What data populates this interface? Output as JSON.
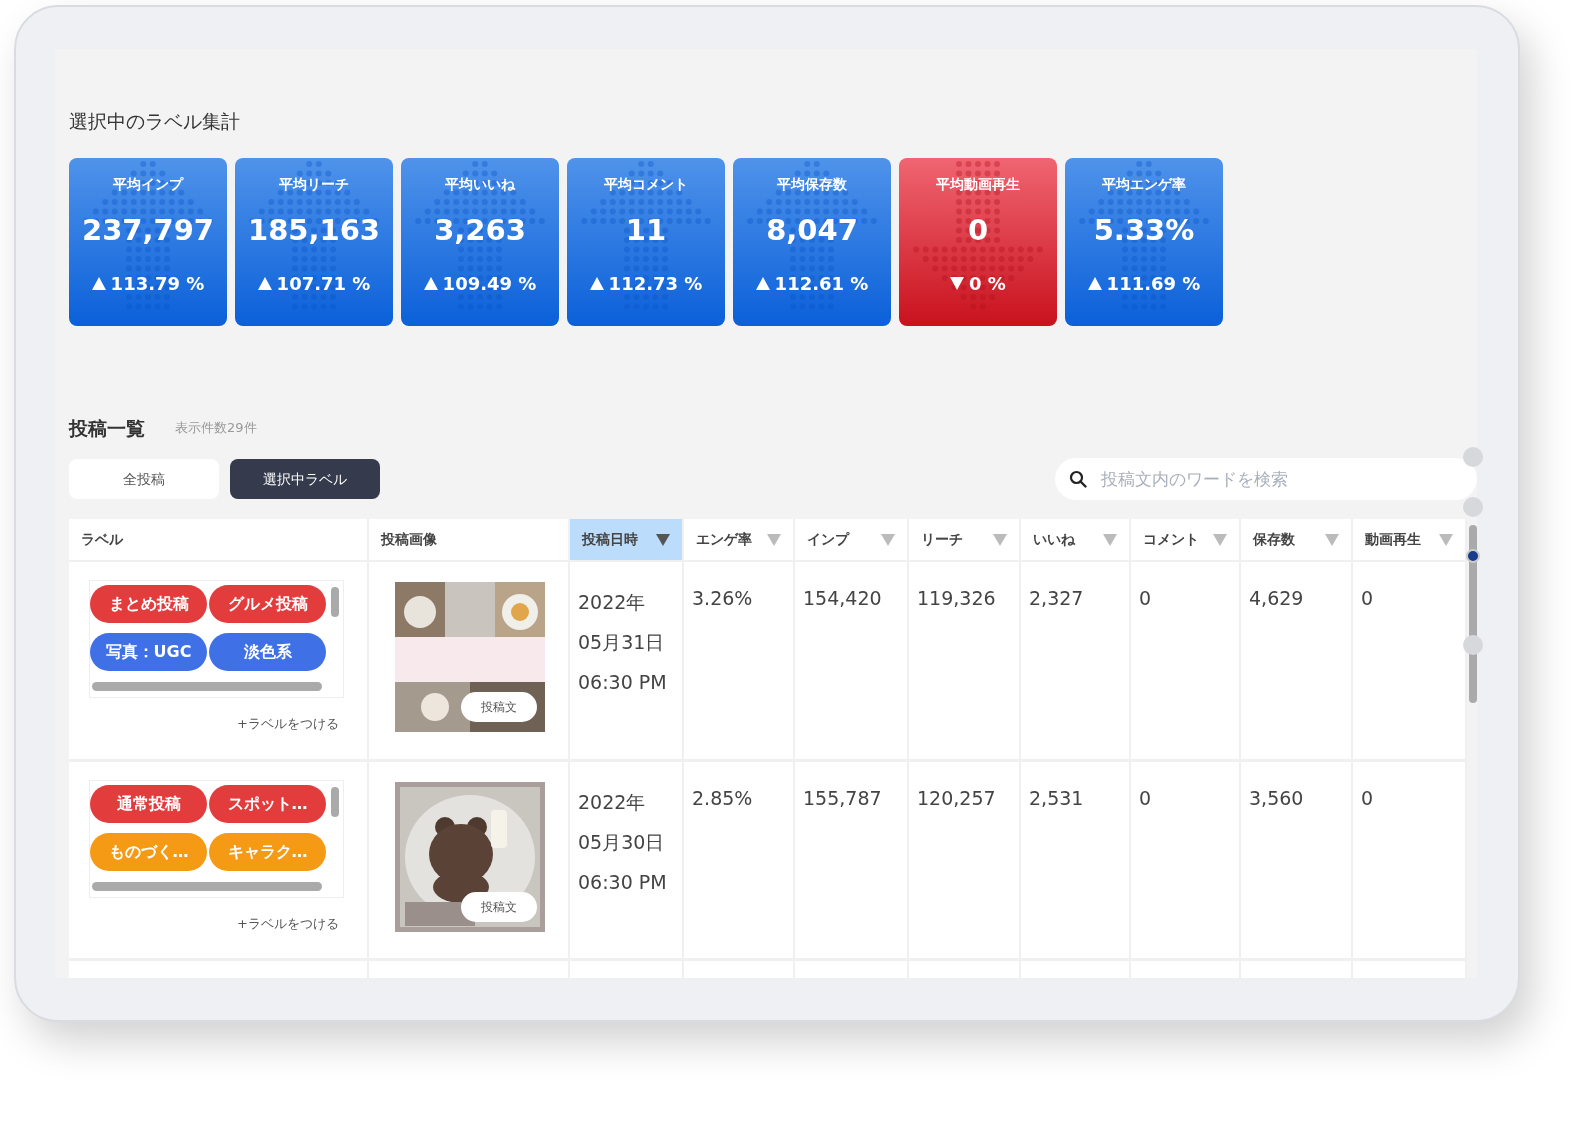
{
  "section_title": "選択中のラベル集計",
  "stat_cards": [
    {
      "title": "平均インプ",
      "value": "237,797",
      "change": "113.79 %",
      "up": true
    },
    {
      "title": "平均リーチ",
      "value": "185,163",
      "change": "107.71 %",
      "up": true
    },
    {
      "title": "平均いいね",
      "value": "3,263",
      "change": "109.49 %",
      "up": true
    },
    {
      "title": "平均コメント",
      "value": "11",
      "change": "112.73 %",
      "up": true
    },
    {
      "title": "平均保存数",
      "value": "8,047",
      "change": "112.61 %",
      "up": true
    },
    {
      "title": "平均動画再生",
      "value": "0",
      "change": "0 %",
      "up": false
    },
    {
      "title": "平均エンゲ率",
      "value": "5.33%",
      "change": "111.69 %",
      "up": true
    }
  ],
  "posts_heading": "投稿一覧",
  "count_label": "表示件数29件",
  "tabs": [
    {
      "label": "全投稿",
      "selected": false
    },
    {
      "label": "選択中ラベル",
      "selected": true
    }
  ],
  "search": {
    "placeholder": "投稿文内のワードを検索"
  },
  "table": {
    "columns": [
      {
        "label": "ラベル",
        "sortable": false,
        "sorted": false
      },
      {
        "label": "投稿画像",
        "sortable": false,
        "sorted": false
      },
      {
        "label": "投稿日時",
        "sortable": true,
        "sorted": true
      },
      {
        "label": "エンゲ率",
        "sortable": true,
        "sorted": false
      },
      {
        "label": "インプ",
        "sortable": true,
        "sorted": false
      },
      {
        "label": "リーチ",
        "sortable": true,
        "sorted": false
      },
      {
        "label": "いいね",
        "sortable": true,
        "sorted": false
      },
      {
        "label": "コメント",
        "sortable": true,
        "sorted": false
      },
      {
        "label": "保存数",
        "sortable": true,
        "sorted": false
      },
      {
        "label": "動画再生",
        "sortable": true,
        "sorted": false
      }
    ],
    "rows": [
      {
        "cells": [
          {
            "kind": "tags",
            "tags": [
              {
                "text": "まとめ投稿",
                "color": "#e23c3c"
              },
              {
                "text": "グルメ投稿",
                "color": "#e23c3c"
              },
              {
                "text": "写真：UGC",
                "color": "#3f70e6"
              },
              {
                "text": "淡色系",
                "color": "#3f70e6"
              }
            ],
            "link": "+ラベルをつける"
          },
          {
            "kind": "picture",
            "button": "投稿文"
          },
          {
            "kind": "lines",
            "lines": [
              "2022年",
              "05月31日",
              "06:30 PM"
            ]
          },
          {
            "kind": "text",
            "text": "3.26%"
          },
          {
            "kind": "text",
            "text": "154,420"
          },
          {
            "kind": "text",
            "text": "119,326"
          },
          {
            "kind": "text",
            "text": "2,327"
          },
          {
            "kind": "text",
            "text": "0"
          },
          {
            "kind": "text",
            "text": "4,629"
          },
          {
            "kind": "text",
            "text": "0"
          }
        ]
      },
      {
        "cells": [
          {
            "kind": "tags",
            "tags": [
              {
                "text": "通常投稿",
                "color": "#e23c3c"
              },
              {
                "text": "スポット…",
                "color": "#e23c3c"
              },
              {
                "text": "ものづく…",
                "color": "#f59a14"
              },
              {
                "text": "キャラク…",
                "color": "#f59a14"
              }
            ],
            "link": "+ラベルをつける"
          },
          {
            "kind": "picture",
            "button": "投稿文"
          },
          {
            "kind": "lines",
            "lines": [
              "2022年",
              "05月30日",
              "06:30 PM"
            ]
          },
          {
            "kind": "text",
            "text": "2.85%"
          },
          {
            "kind": "text",
            "text": "155,787"
          },
          {
            "kind": "text",
            "text": "120,257"
          },
          {
            "kind": "text",
            "text": "2,531"
          },
          {
            "kind": "text",
            "text": "0"
          },
          {
            "kind": "text",
            "text": "3,560"
          },
          {
            "kind": "text",
            "text": "0"
          }
        ]
      }
    ]
  }
}
